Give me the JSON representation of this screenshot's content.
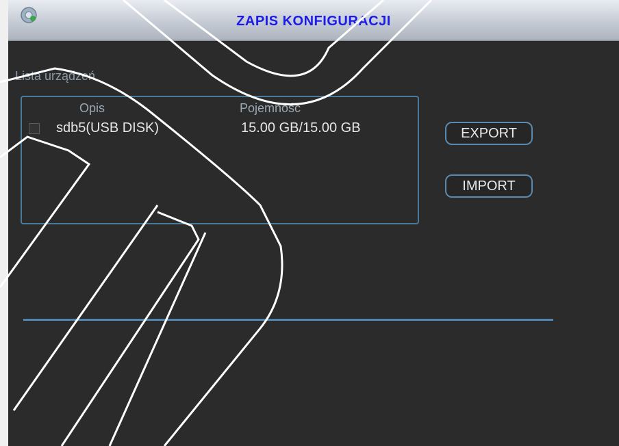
{
  "window": {
    "title": "ZAPIS KONFIGURACJI"
  },
  "devices": {
    "section_label": "Lista urządzeń",
    "columns": {
      "description": "Opis",
      "capacity": "Pojemność"
    },
    "rows": [
      {
        "description": "sdb5(USB DISK)",
        "capacity": "15.00 GB/15.00 GB",
        "checked": false
      }
    ]
  },
  "actions": {
    "export_label": "EXPORT",
    "import_label": "IMPORT"
  },
  "progress": {
    "value": 1.0
  },
  "colors": {
    "title_text": "#1c1ce8",
    "panel_bg": "#2b2b2b",
    "accent_border": "#4a7a9a",
    "progress_fill": "#4f86b3"
  }
}
